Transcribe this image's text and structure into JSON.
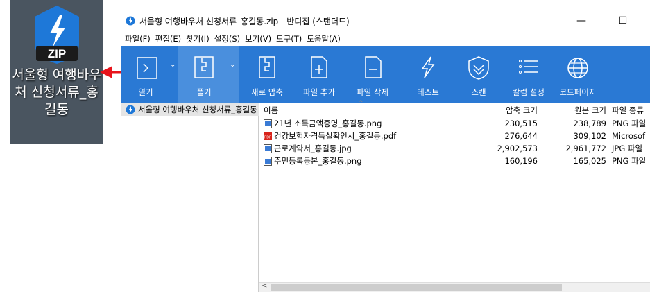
{
  "desktop_icon": {
    "badge": "ZIP",
    "label": "서울형 여행바우처 신청서류_홍길동"
  },
  "window": {
    "title": "서울형 여행바우처 신청서류_홍길동.zip - 반디집 (스탠더드)",
    "minimize_glyph": "—",
    "maximize_glyph": "☐"
  },
  "menu": [
    "파일(F)",
    "편집(E)",
    "찾기(I)",
    "설정(S)",
    "보기(V)",
    "도구(T)",
    "도움말(A)"
  ],
  "toolbar": {
    "open": "열기",
    "extract": "풀기",
    "new_archive": "새로 압축",
    "add_file": "파일 추가",
    "delete_file": "파일 삭제",
    "test": "테스트",
    "scan": "스캔",
    "column_settings": "칼럼 설정",
    "codepage": "코드페이지",
    "dropdown_glyph": "⌄"
  },
  "tree": {
    "root": "서울형 여행바우처 신청서류_홍길동"
  },
  "filelist": {
    "headers": {
      "name": "이름",
      "compressed": "압축 크기",
      "original": "원본 크기",
      "type": "파일 종류"
    },
    "rows": [
      {
        "name": "21년 소득금액증명_홍길동.png",
        "compressed": "230,515",
        "original": "238,789",
        "type": "PNG 파일",
        "kind": "image"
      },
      {
        "name": "건강보험자격득실확인서_홍길동.pdf",
        "compressed": "276,644",
        "original": "309,102",
        "type": "Microsof",
        "kind": "pdf"
      },
      {
        "name": "근로계약서_홍길동.jpg",
        "compressed": "2,902,573",
        "original": "2,961,772",
        "type": "JPG 파일",
        "kind": "image"
      },
      {
        "name": "주민등록등본_홍길동.png",
        "compressed": "160,196",
        "original": "165,025",
        "type": "PNG 파일",
        "kind": "image"
      }
    ],
    "scroll_left_glyph": "<"
  },
  "colors": {
    "toolbar_bg": "#2a79d4",
    "toolbar_active": "#4a8fdd",
    "arrow_red": "#e8141c",
    "desktop_bg": "#4a5560"
  }
}
